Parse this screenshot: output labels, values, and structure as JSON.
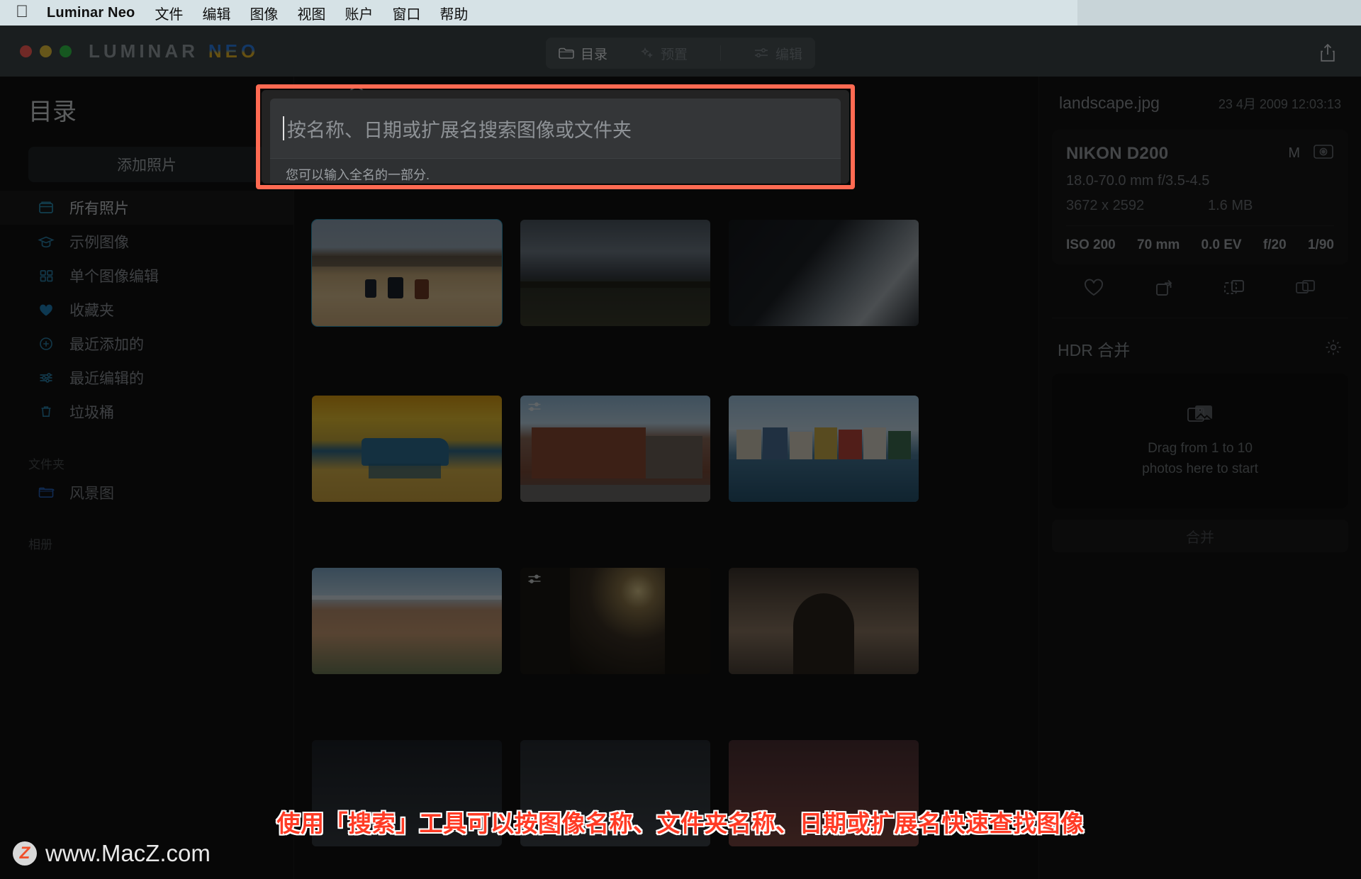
{
  "menubar": {
    "apple_icon": "apple-logo-icon",
    "app_name": "Luminar Neo",
    "items": [
      "文件",
      "编辑",
      "图像",
      "视图",
      "账户",
      "窗口",
      "帮助"
    ]
  },
  "titlebar": {
    "logo_primary": "LUMINAR",
    "logo_secondary": "NEO",
    "tabs": [
      {
        "label": "目录",
        "icon": "folder-icon",
        "active": true
      },
      {
        "label": "预置",
        "icon": "sparkle-icon",
        "active": false
      },
      {
        "label": "编辑",
        "icon": "sliders-icon",
        "active": false
      }
    ],
    "share_icon": "share-upload-icon"
  },
  "sidebar": {
    "title": "目录",
    "add_photos_label": "添加照片",
    "items": [
      {
        "label": "所有照片",
        "icon": "library-icon",
        "active": true
      },
      {
        "label": "示例图像",
        "icon": "graduation-cap-icon",
        "active": false
      },
      {
        "label": "单个图像编辑",
        "icon": "grid-squares-icon",
        "active": false
      },
      {
        "label": "收藏夹",
        "icon": "heart-icon",
        "active": false
      },
      {
        "label": "最近添加的",
        "icon": "plus-circle-icon",
        "active": false
      },
      {
        "label": "最近编辑的",
        "icon": "sliders-icon",
        "active": false
      },
      {
        "label": "垃圾桶",
        "icon": "trash-icon",
        "active": false
      }
    ],
    "folders_section_label": "文件夹",
    "folders": [
      {
        "label": "风景图",
        "icon": "folder-icon"
      }
    ],
    "albums_section_label": "相册"
  },
  "search_dialog": {
    "magnifier_icon": "search-icon",
    "placeholder": "按名称、日期或扩展名搜索图像或文件夹",
    "value": "",
    "hint": "您可以输入全名的一部分."
  },
  "right_panel": {
    "filename": "landscape.jpg",
    "date": "23 4月 2009 12:03:13",
    "camera": "NIKON D200",
    "exposure_mode": "M",
    "camera_icon": "camera-icon",
    "lens": "18.0-70.0 mm f/3.5-4.5",
    "dimensions": "3672 x 2592",
    "filesize": "1.6 MB",
    "exif": [
      "ISO 200",
      "70 mm",
      "0.0 EV",
      "f/20",
      "1/90"
    ],
    "actions": [
      {
        "icon": "heart-icon",
        "name": "favorite"
      },
      {
        "icon": "rotate-icon",
        "name": "rotate"
      },
      {
        "icon": "copy-dashed-icon",
        "name": "duplicate-virtual"
      },
      {
        "icon": "stack-icon",
        "name": "stack"
      }
    ],
    "hdr": {
      "title": "HDR 合并",
      "settings_icon": "gear-icon",
      "drop_icon": "photos-stack-icon",
      "drop_text_line1": "Drag from 1 to 10",
      "drop_text_line2": "photos here to start",
      "merge_button_label": "合并"
    }
  },
  "photo_grid": {
    "rows": [
      [
        {
          "name": "cattle-on-dirt-road",
          "selected": true
        },
        {
          "name": "dark-field-storm",
          "selected": false
        },
        {
          "name": "clouds-dark",
          "selected": false
        }
      ],
      [
        {
          "name": "iceberg-golden-sunset",
          "selected": false
        },
        {
          "name": "brick-main-street",
          "selected": false
        },
        {
          "name": "burano-colored-houses",
          "selected": false
        }
      ],
      [
        {
          "name": "canyon-hoodoos",
          "selected": false
        },
        {
          "name": "night-alley-lamp",
          "selected": false
        },
        {
          "name": "stone-archway",
          "selected": false
        }
      ],
      [
        {
          "name": "tree-silhouette",
          "selected": false
        },
        {
          "name": "rocky-shore",
          "selected": false
        },
        {
          "name": "sunset-mountains",
          "selected": false
        }
      ]
    ]
  },
  "annotation": {
    "caption": "使用「搜索」工具可以按图像名称、文件夹名称、日期或扩展名快速查找图像",
    "highlight_color": "#ff6a52",
    "caption_color": "#ff3b25"
  },
  "watermark": {
    "badge": "Z",
    "text": "www.MacZ.com"
  }
}
